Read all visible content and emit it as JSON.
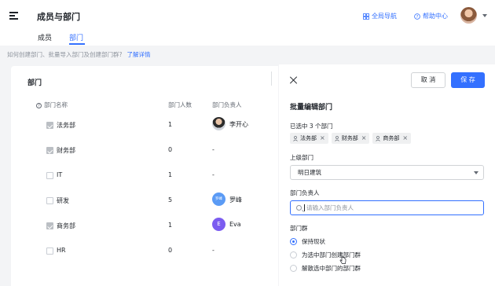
{
  "header": {
    "title": "成员与部门",
    "global_nav": "全局导航",
    "help_center": "帮助中心"
  },
  "tabs": [
    {
      "label": "成员",
      "active": false
    },
    {
      "label": "部门",
      "active": true
    }
  ],
  "help": {
    "text": "如何创建部门、批量导入部门及创建部门群?",
    "link": "了解详情"
  },
  "dept_panel": {
    "title": "部门",
    "columns": [
      "部门名称",
      "部门人数",
      "部门负责人"
    ],
    "rows": [
      {
        "name": "法务部",
        "count": "1",
        "leader": "李开心",
        "checked": true,
        "avatar": "photo"
      },
      {
        "name": "财务部",
        "count": "0",
        "leader": "-",
        "checked": true
      },
      {
        "name": "IT",
        "count": "1",
        "leader": "-",
        "checked": false
      },
      {
        "name": "研发",
        "count": "5",
        "leader": "罗峰",
        "checked": false,
        "avatar_text": "罗峰",
        "avatar_color": "#5b9bf5"
      },
      {
        "name": "商务部",
        "count": "1",
        "leader": "Eva",
        "checked": true,
        "avatar_text": "E",
        "avatar_color": "#7b5cf0"
      },
      {
        "name": "HR",
        "count": "0",
        "leader": "-",
        "checked": false
      }
    ]
  },
  "drawer": {
    "cancel": "取 消",
    "save": "保 存",
    "title": "批量编辑部门",
    "selected_label": "已选中 3 个部门",
    "selected_tags": [
      "法务部",
      "财务部",
      "商务部"
    ],
    "parent_label": "上级部门",
    "parent_value": "明日建筑",
    "leader_label": "部门负责人",
    "leader_placeholder": "请输入部门负责人",
    "group_label": "部门群",
    "radio_options": [
      {
        "label": "保持现状",
        "selected": true
      },
      {
        "label": "为选中部门创建部门群",
        "selected": false
      },
      {
        "label": "解散选中部门的部门群",
        "selected": false
      }
    ]
  }
}
